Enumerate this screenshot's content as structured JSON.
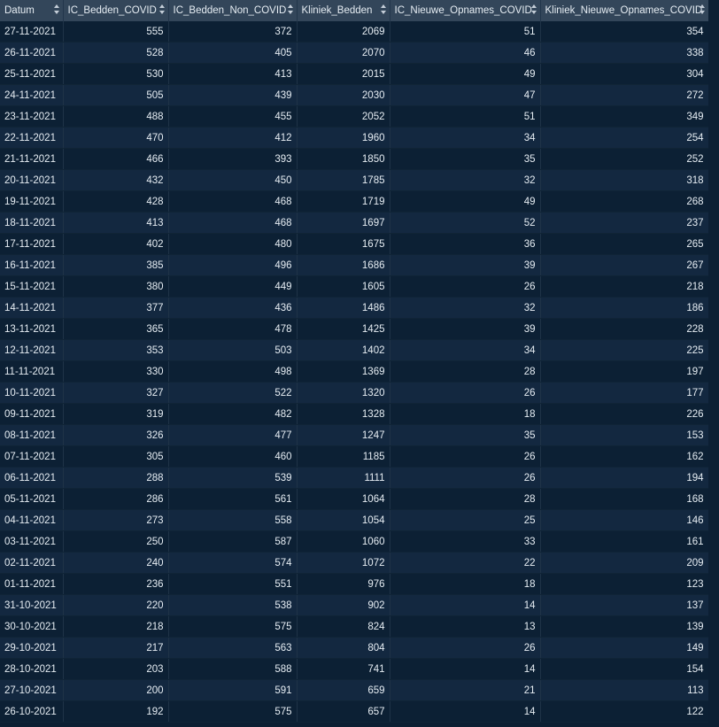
{
  "columns": [
    "Datum",
    "IC_Bedden_COVID",
    "IC_Bedden_Non_COVID",
    "Kliniek_Bedden",
    "IC_Nieuwe_Opnames_COVID",
    "Kliniek_Nieuwe_Opnames_COVID"
  ],
  "rows": [
    [
      "27-11-2021",
      "555",
      "372",
      "2069",
      "51",
      "354"
    ],
    [
      "26-11-2021",
      "528",
      "405",
      "2070",
      "46",
      "338"
    ],
    [
      "25-11-2021",
      "530",
      "413",
      "2015",
      "49",
      "304"
    ],
    [
      "24-11-2021",
      "505",
      "439",
      "2030",
      "47",
      "272"
    ],
    [
      "23-11-2021",
      "488",
      "455",
      "2052",
      "51",
      "349"
    ],
    [
      "22-11-2021",
      "470",
      "412",
      "1960",
      "34",
      "254"
    ],
    [
      "21-11-2021",
      "466",
      "393",
      "1850",
      "35",
      "252"
    ],
    [
      "20-11-2021",
      "432",
      "450",
      "1785",
      "32",
      "318"
    ],
    [
      "19-11-2021",
      "428",
      "468",
      "1719",
      "49",
      "268"
    ],
    [
      "18-11-2021",
      "413",
      "468",
      "1697",
      "52",
      "237"
    ],
    [
      "17-11-2021",
      "402",
      "480",
      "1675",
      "36",
      "265"
    ],
    [
      "16-11-2021",
      "385",
      "496",
      "1686",
      "39",
      "267"
    ],
    [
      "15-11-2021",
      "380",
      "449",
      "1605",
      "26",
      "218"
    ],
    [
      "14-11-2021",
      "377",
      "436",
      "1486",
      "32",
      "186"
    ],
    [
      "13-11-2021",
      "365",
      "478",
      "1425",
      "39",
      "228"
    ],
    [
      "12-11-2021",
      "353",
      "503",
      "1402",
      "34",
      "225"
    ],
    [
      "11-11-2021",
      "330",
      "498",
      "1369",
      "28",
      "197"
    ],
    [
      "10-11-2021",
      "327",
      "522",
      "1320",
      "26",
      "177"
    ],
    [
      "09-11-2021",
      "319",
      "482",
      "1328",
      "18",
      "226"
    ],
    [
      "08-11-2021",
      "326",
      "477",
      "1247",
      "35",
      "153"
    ],
    [
      "07-11-2021",
      "305",
      "460",
      "1185",
      "26",
      "162"
    ],
    [
      "06-11-2021",
      "288",
      "539",
      "1111",
      "26",
      "194"
    ],
    [
      "05-11-2021",
      "286",
      "561",
      "1064",
      "28",
      "168"
    ],
    [
      "04-11-2021",
      "273",
      "558",
      "1054",
      "25",
      "146"
    ],
    [
      "03-11-2021",
      "250",
      "587",
      "1060",
      "33",
      "161"
    ],
    [
      "02-11-2021",
      "240",
      "574",
      "1072",
      "22",
      "209"
    ],
    [
      "01-11-2021",
      "236",
      "551",
      "976",
      "18",
      "123"
    ],
    [
      "31-10-2021",
      "220",
      "538",
      "902",
      "14",
      "137"
    ],
    [
      "30-10-2021",
      "218",
      "575",
      "824",
      "13",
      "139"
    ],
    [
      "29-10-2021",
      "217",
      "563",
      "804",
      "26",
      "149"
    ],
    [
      "28-10-2021",
      "203",
      "588",
      "741",
      "14",
      "154"
    ],
    [
      "27-10-2021",
      "200",
      "591",
      "659",
      "21",
      "113"
    ],
    [
      "26-10-2021",
      "192",
      "575",
      "657",
      "14",
      "122"
    ]
  ],
  "colors": {
    "header_bg": "#33465a",
    "row_odd": "#0c2034",
    "row_even": "#132840",
    "text": "#e6edf3"
  }
}
